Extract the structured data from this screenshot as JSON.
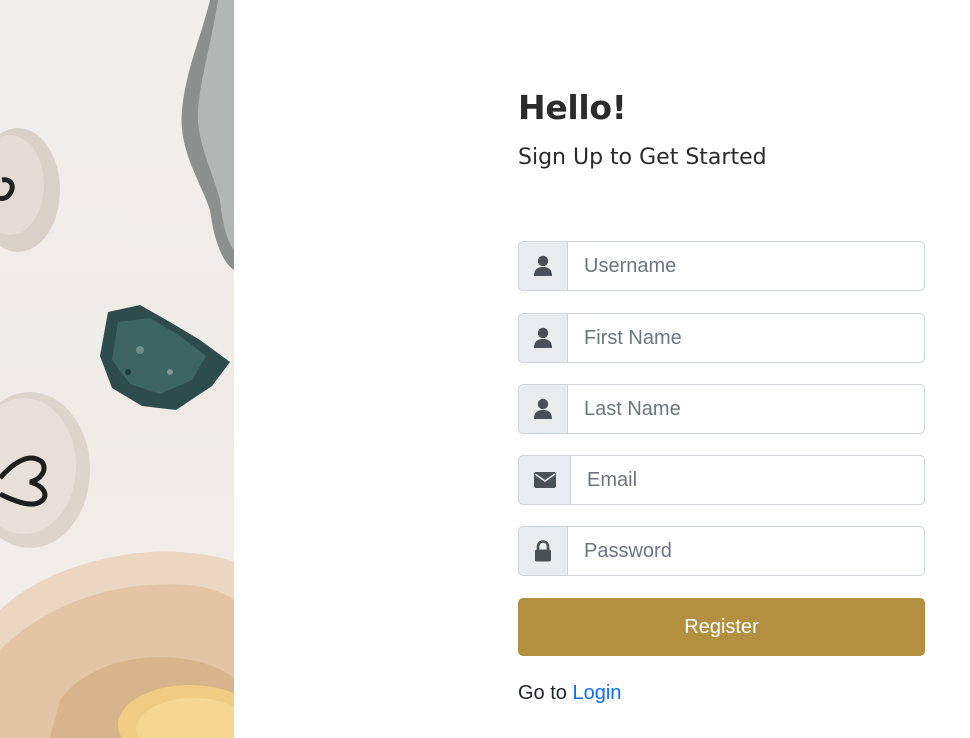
{
  "heading": "Hello!",
  "subheading": "Sign Up to Get Started",
  "fields": [
    {
      "placeholder": "Username",
      "icon": "user-icon",
      "value": ""
    },
    {
      "placeholder": "First Name",
      "icon": "user-icon",
      "value": ""
    },
    {
      "placeholder": "Last Name",
      "icon": "user-icon",
      "value": ""
    },
    {
      "placeholder": "Email",
      "icon": "envelope-icon",
      "value": ""
    },
    {
      "placeholder": "Password",
      "icon": "lock-icon",
      "value": ""
    }
  ],
  "register_label": "Register",
  "login_prompt": "Go to",
  "login_link": "Login",
  "colors": {
    "accent": "#b3903f",
    "link": "#0d6efd",
    "addon_bg": "#e9ecef",
    "icon": "#495057"
  }
}
